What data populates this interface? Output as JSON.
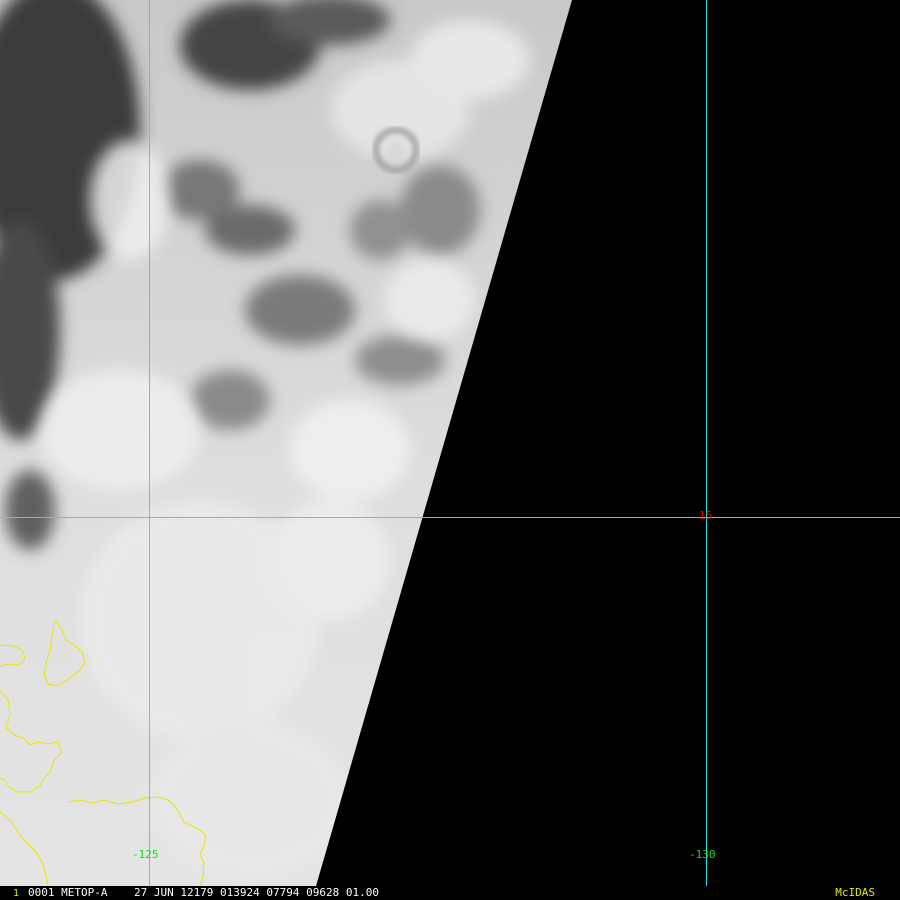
{
  "graticule": {
    "color": "#22e0e6",
    "latitude_label": "15",
    "latitude_label_color": "#d01010",
    "longitude_labels": [
      "-125",
      "-130"
    ],
    "longitude_label_color": "#22d822"
  },
  "coastline_color": "#e6e600",
  "status_bar": {
    "frame": "1",
    "frame_color": "#e6e600",
    "text": "0001 METOP-A    27 JUN 12179 013924 07794 09628 01.00",
    "text_color": "#ffffff",
    "vendor": "McIDAS",
    "vendor_color": "#e6e600"
  }
}
